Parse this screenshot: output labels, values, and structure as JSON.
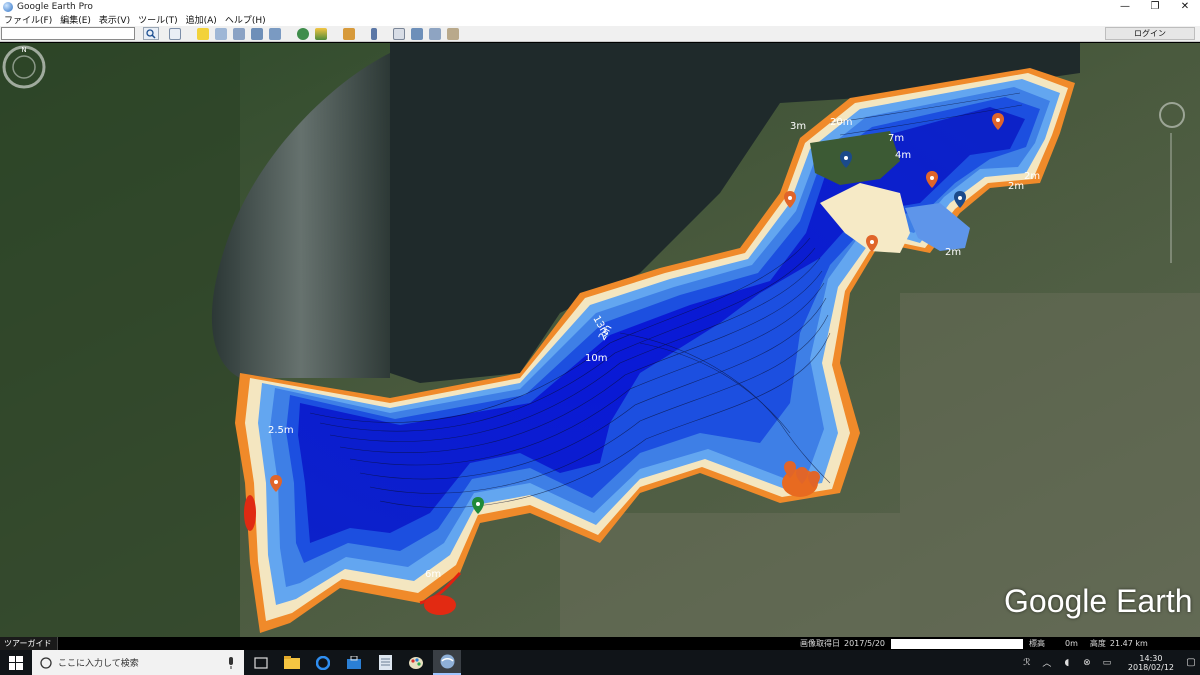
{
  "window": {
    "title": "Google Earth Pro",
    "minimize": "—",
    "restore": "❐",
    "close": "✕"
  },
  "menu": [
    "ファイル(F)",
    "編集(E)",
    "表示(V)",
    "ツール(T)",
    "追加(A)",
    "ヘルプ(H)"
  ],
  "toolbar": {
    "search_value": "",
    "login_label": "ログイン",
    "icons": [
      "sidebar-toggle-icon",
      "placemark-icon",
      "polygon-icon",
      "path-icon",
      "overlay-icon",
      "record-tour-icon",
      "history-icon",
      "sun-icon",
      "planets-icon",
      "ruler-icon",
      "email-icon",
      "print-icon",
      "save-image-icon",
      "maps-icon"
    ]
  },
  "map": {
    "depth_labels": [
      "20m",
      "3m",
      "7m",
      "4m",
      "2m",
      "2m",
      "2m",
      "13m",
      "10m",
      "2m",
      "2.5m",
      "6m"
    ],
    "logo": "Google Earth"
  },
  "statusbar": {
    "tour_guide": "ツアーガイド",
    "date_label": "画像取得日",
    "date": "2017/5/20",
    "elevation_label": "標高",
    "elevation": "0m",
    "altitude_label": "高度",
    "altitude": "21.47 km"
  },
  "taskbar": {
    "search_placeholder": "ここに入力して検索",
    "time": "14:30",
    "date": "2018/02/12"
  }
}
